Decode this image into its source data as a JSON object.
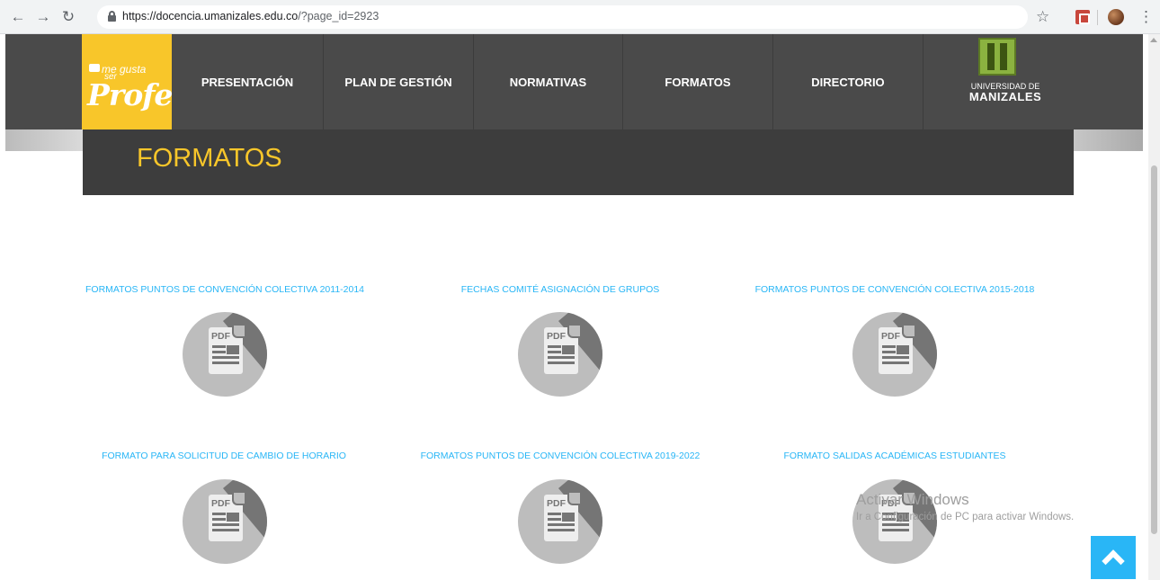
{
  "browser": {
    "url_host": "https://docencia.umanizales.edu.co",
    "url_path": "/?page_id=2923",
    "icons": [
      "back-icon",
      "forward-icon",
      "reload-icon",
      "lock-icon",
      "star-icon",
      "pdf-extension-icon",
      "profile-avatar",
      "menu-icon"
    ]
  },
  "header": {
    "logo": {
      "line1": "me gusta",
      "line2": "ser",
      "main": "Profe"
    },
    "nav": [
      "PRESENTACIÓN",
      "PLAN DE GESTIÓN",
      "NORMATIVAS",
      "FORMATOS",
      "DIRECTORIO"
    ],
    "university": {
      "line1": "UNIVERSIDAD DE",
      "line2": "MANIZALES"
    }
  },
  "page": {
    "title": "FORMATOS"
  },
  "documents": [
    {
      "title": "FORMATOS PUNTOS DE CONVENCIÓN COLECTIVA 2011-2014",
      "badge": "PDF"
    },
    {
      "title": "FECHAS COMITÉ ASIGNACIÓN DE GRUPOS",
      "badge": "PDF"
    },
    {
      "title": "FORMATOS PUNTOS DE CONVENCIÓN COLECTIVA 2015-2018",
      "badge": "PDF"
    },
    {
      "title": "FORMATO PARA SOLICITUD DE CAMBIO DE HORARIO",
      "badge": "PDF"
    },
    {
      "title": "FORMATOS PUNTOS DE CONVENCIÓN COLECTIVA 2019-2022",
      "badge": "PDF"
    },
    {
      "title": "FORMATO SALIDAS ACADÉMICAS ESTUDIANTES",
      "badge": "PDF"
    }
  ],
  "watermark": {
    "line1": "Activar Windows",
    "line2": "Ir a Configuración de PC para activar Windows."
  },
  "colors": {
    "accent_yellow": "#f8c62a",
    "link_blue": "#29b6f6",
    "nav_bg": "#4a4a4a",
    "title_bg": "#3d3d3d",
    "icon_grey": "#bdbdbd"
  }
}
